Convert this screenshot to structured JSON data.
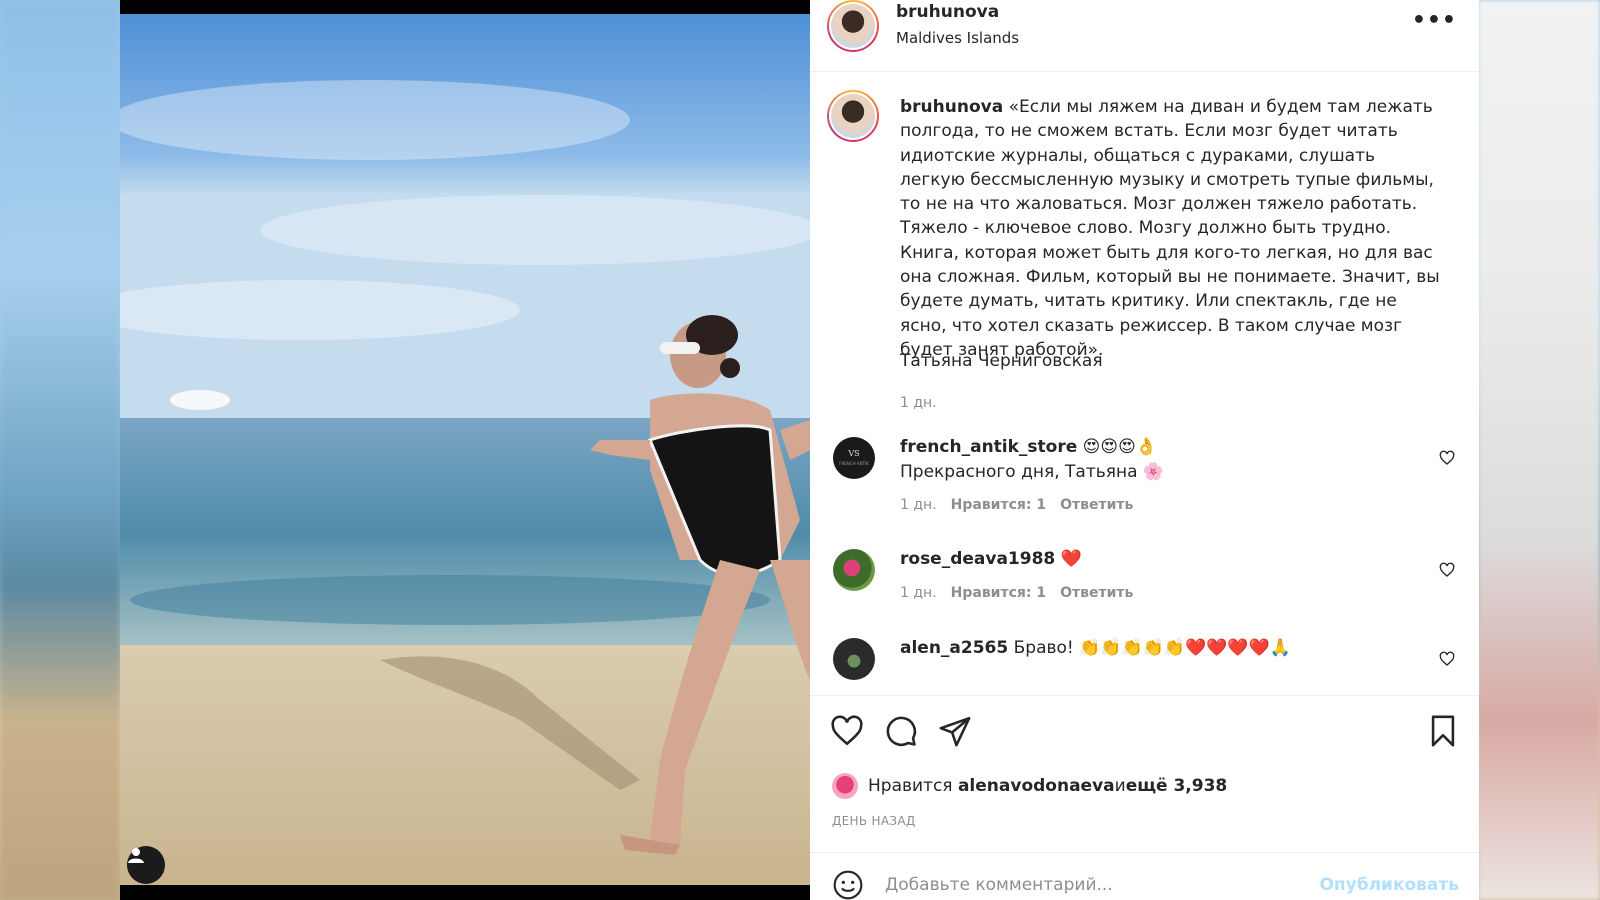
{
  "post": {
    "username": "bruhunova",
    "location": "Maldives Islands",
    "more_label": "•••"
  },
  "caption": {
    "username": "bruhunova",
    "text": " «Если мы ляжем на диван и будем там лежать полгода, то не сможем встать. Если мозг будет читать идиотские журналы, общаться с дураками, слушать легкую бессмысленную музыку и смотреть тупые фильмы, то не на что жаловаться. Мозг должен тяжело работать. Тяжело - ключевое слово. Мозгу должно быть трудно. Книга, которая может быть для кого-то легкая, но для вас она сложная. Фильм, который вы не понимаете. Значит, вы будете думать, читать критику. Или спектакль, где не ясно, что хотел сказать режиссер. В таком случае мозг будет занят работой».",
    "author": "Татьяна Черниговская",
    "time": "1 дн."
  },
  "comments": [
    {
      "username": "french_antik_store",
      "line1": " 😍😍😍👌",
      "line2": "Прекрасного дня, Татьяна 🌸",
      "time": "1 дн.",
      "likes": "Нравится: 1",
      "reply": "Ответить",
      "avatar_color": "#1a1a1a"
    },
    {
      "username": "rose_deava1988",
      "line1": " ❤️",
      "time": "1 дн.",
      "likes": "Нравится: 1",
      "reply": "Ответить",
      "avatar_color": "#3d6b2a"
    },
    {
      "username": "alen_a2565",
      "line1": " Браво! 👏👏👏👏👏❤️❤️❤️❤️🙏",
      "avatar_color": "#2b2b2b"
    }
  ],
  "actions": {
    "like_icon": "heart-icon",
    "comment_icon": "comment-icon",
    "share_icon": "send-icon",
    "save_icon": "bookmark-icon"
  },
  "likes": {
    "prefix": "Нравится ",
    "user": "alenavodonaeva",
    "middle": " и ",
    "count": "ещё 3,938"
  },
  "posted": "ДЕНЬ НАЗАД",
  "add_comment": {
    "placeholder": "Добавьте комментарий...",
    "publish": "Опубликовать"
  },
  "colors": {
    "text": "#262626",
    "muted": "#8e8e8e",
    "publish_disabled": "#b2dffc",
    "heart_red": "#ed4956"
  }
}
